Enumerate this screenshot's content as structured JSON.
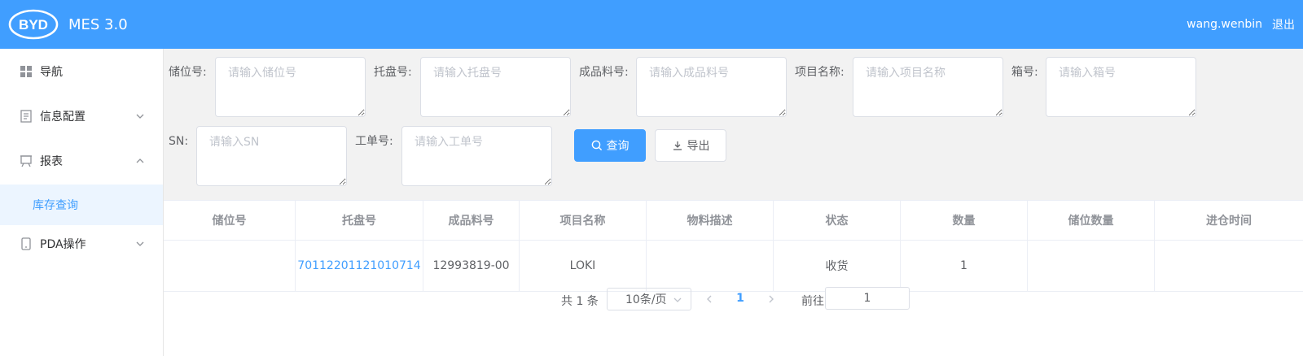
{
  "colors": {
    "primary": "#409eff",
    "active_bg": "#ecf5ff",
    "filter_bg": "#f2f2f2"
  },
  "header": {
    "logo_text": "BYD",
    "title": "MES 3.0",
    "username": "wang.wenbin",
    "logout": "退出"
  },
  "sidebar": {
    "items": [
      {
        "label": "导航",
        "icon": "grid-icon"
      },
      {
        "label": "信息配置",
        "icon": "document-icon",
        "expanded": false
      },
      {
        "label": "报表",
        "icon": "presentation-icon",
        "expanded": true
      },
      {
        "label": "PDA操作",
        "icon": "tablet-icon",
        "expanded": false
      }
    ],
    "submenu": {
      "label": "库存查询",
      "active": true
    }
  },
  "filters": {
    "location": {
      "label": "储位号:",
      "placeholder": "请输入储位号"
    },
    "pallet": {
      "label": "托盘号:",
      "placeholder": "请输入托盘号"
    },
    "product": {
      "label": "成品料号:",
      "placeholder": "请输入成品料号"
    },
    "project": {
      "label": "项目名称:",
      "placeholder": "请输入项目名称"
    },
    "box": {
      "label": "箱号:",
      "placeholder": "请输入箱号"
    },
    "sn": {
      "label": "SN:",
      "placeholder": "请输入SN"
    },
    "workorder": {
      "label": "工单号:",
      "placeholder": "请输入工单号"
    },
    "query_button": "查询",
    "export_button": "导出"
  },
  "table": {
    "columns": [
      "储位号",
      "托盘号",
      "成品料号",
      "项目名称",
      "物料描述",
      "状态",
      "数量",
      "储位数量",
      "进仓时间"
    ],
    "rows": [
      [
        "",
        "70112201121010714",
        "12993819-00",
        "LOKI",
        "",
        "收货",
        "1",
        "",
        ""
      ]
    ]
  },
  "pagination": {
    "total": "共 1 条",
    "page_size": "10条/页",
    "current": "1",
    "goto_label": "前往",
    "goto_value": "1"
  }
}
